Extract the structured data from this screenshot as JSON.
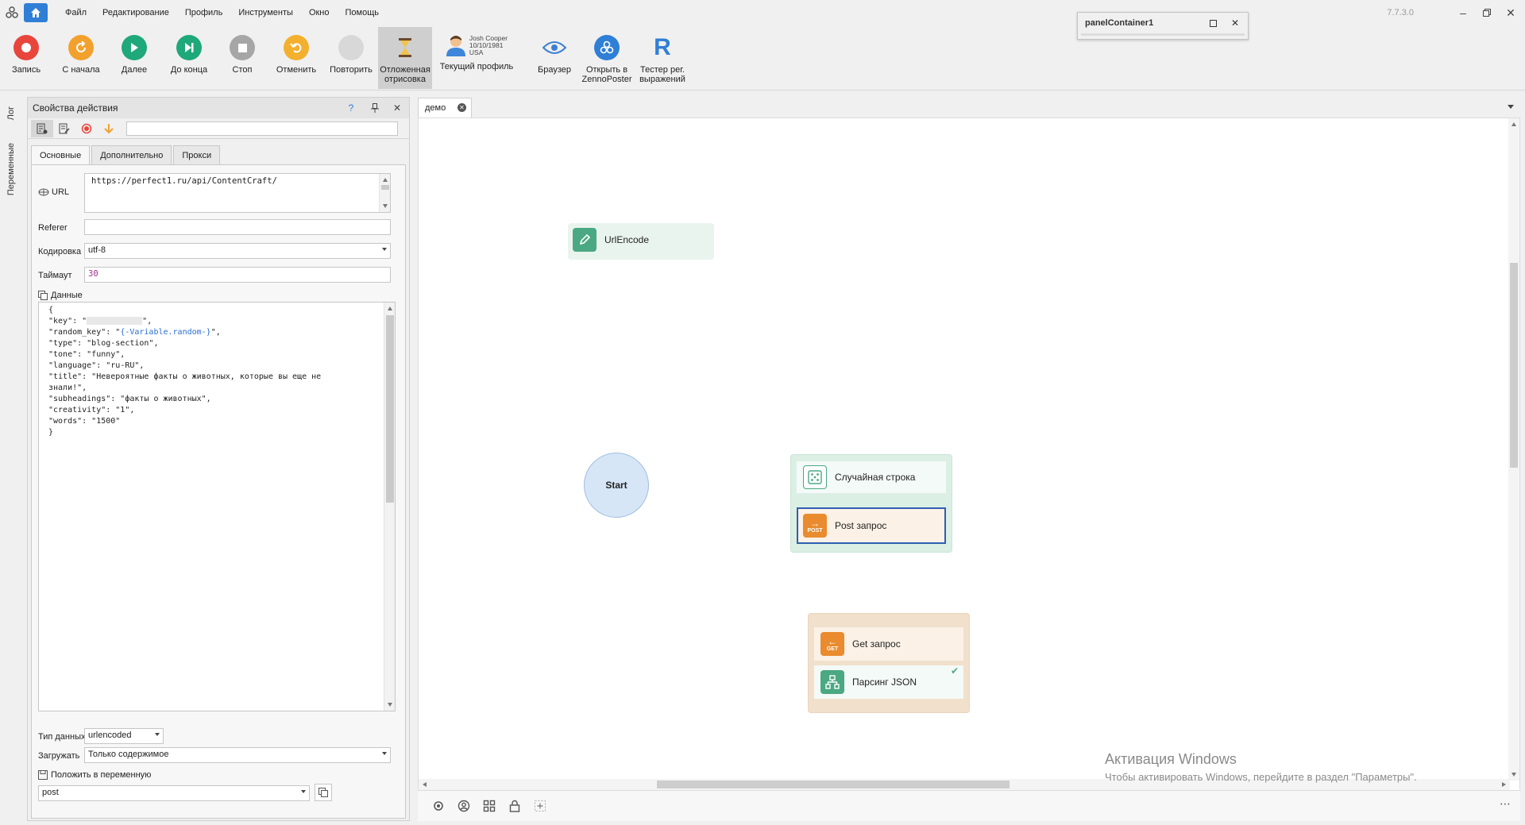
{
  "app": {
    "version": "7.7.3.0",
    "menu": [
      "Файл",
      "Редактирование",
      "Профиль",
      "Инструменты",
      "Окно",
      "Помощь"
    ]
  },
  "toolbar": {
    "record": "Запись",
    "restart": "С начала",
    "next": "Далее",
    "to_end": "До конца",
    "stop": "Стоп",
    "undo": "Отменить",
    "redo": "Повторить",
    "deferred_line1": "Отложенная",
    "deferred_line2": "отрисовка",
    "profile_name": "Josh Cooper",
    "profile_date": "10/10/1981",
    "profile_country": "USA",
    "current_profile": "Текущий профиль",
    "browser": "Браузер",
    "open_in_line1": "Открыть в",
    "open_in_line2": "ZennoPoster",
    "regex_line1": "Тестер рег.",
    "regex_line2": "выражений"
  },
  "side_tabs": {
    "log": "Лог",
    "variables": "Переменные"
  },
  "panel_container": {
    "title": "panelContainer1"
  },
  "props": {
    "title": "Свойства действия",
    "help": "?",
    "tabs": [
      "Основные",
      "Дополнительно",
      "Прокси"
    ],
    "url_label": "URL",
    "url_value": "https://perfect1.ru/api/ContentCraft/",
    "referer_label": "Referer",
    "referer_value": "",
    "encoding_label": "Кодировка",
    "encoding_value": "utf-8",
    "timeout_label": "Таймаут",
    "timeout_value": "30",
    "data_label": "Данные",
    "data_lines": {
      "l1": "{",
      "l2a": "\"key\": \"",
      "l2b": "\",",
      "l3a": "\"random_key\": \"",
      "l3b": "{-Variable.random-}",
      "l3c": "\",",
      "l4": "\"type\": \"blog-section\",",
      "l5": "\"tone\": \"funny\",",
      "l6": "\"language\": \"ru-RU\",",
      "l7": "\"title\": \"Невероятные факты о животных, которые вы еще не",
      "l8": "знали!\",",
      "l9": "\"subheadings\": \"факты о животных\",",
      "l10": "\"creativity\": \"1\",",
      "l11": "\"words\": \"1500\"",
      "l12": "}"
    },
    "data_type_label": "Тип данных",
    "data_type_value": "urlencoded",
    "load_label": "Загружать",
    "load_value": "Только содержимое",
    "put_in_var_label": "Положить в переменную",
    "put_in_var_value": "post"
  },
  "canvas": {
    "tab_label": "демо",
    "nodes": {
      "urlencode": "UrlEncode",
      "start": "Start",
      "random_string": "Случайная строка",
      "post_request": "Post запрос",
      "get_request": "Get запрос",
      "parse_json": "Парсинг JSON"
    },
    "post_badge": "POST",
    "get_badge": "GET"
  },
  "activation": {
    "title": "Активация Windows",
    "subtitle": "Чтобы активировать Windows, перейдите в раздел \"Параметры\"."
  },
  "colors": {
    "accent": "#2f7fd6",
    "record": "#e8453c",
    "restart": "#f2a12e",
    "play": "#1fa87a",
    "stop": "#a6a6a6",
    "node_green": "#4aa882",
    "node_orange": "#e98b2e",
    "group_green": "#dcefe5",
    "group_orange": "#f1e0cc"
  }
}
